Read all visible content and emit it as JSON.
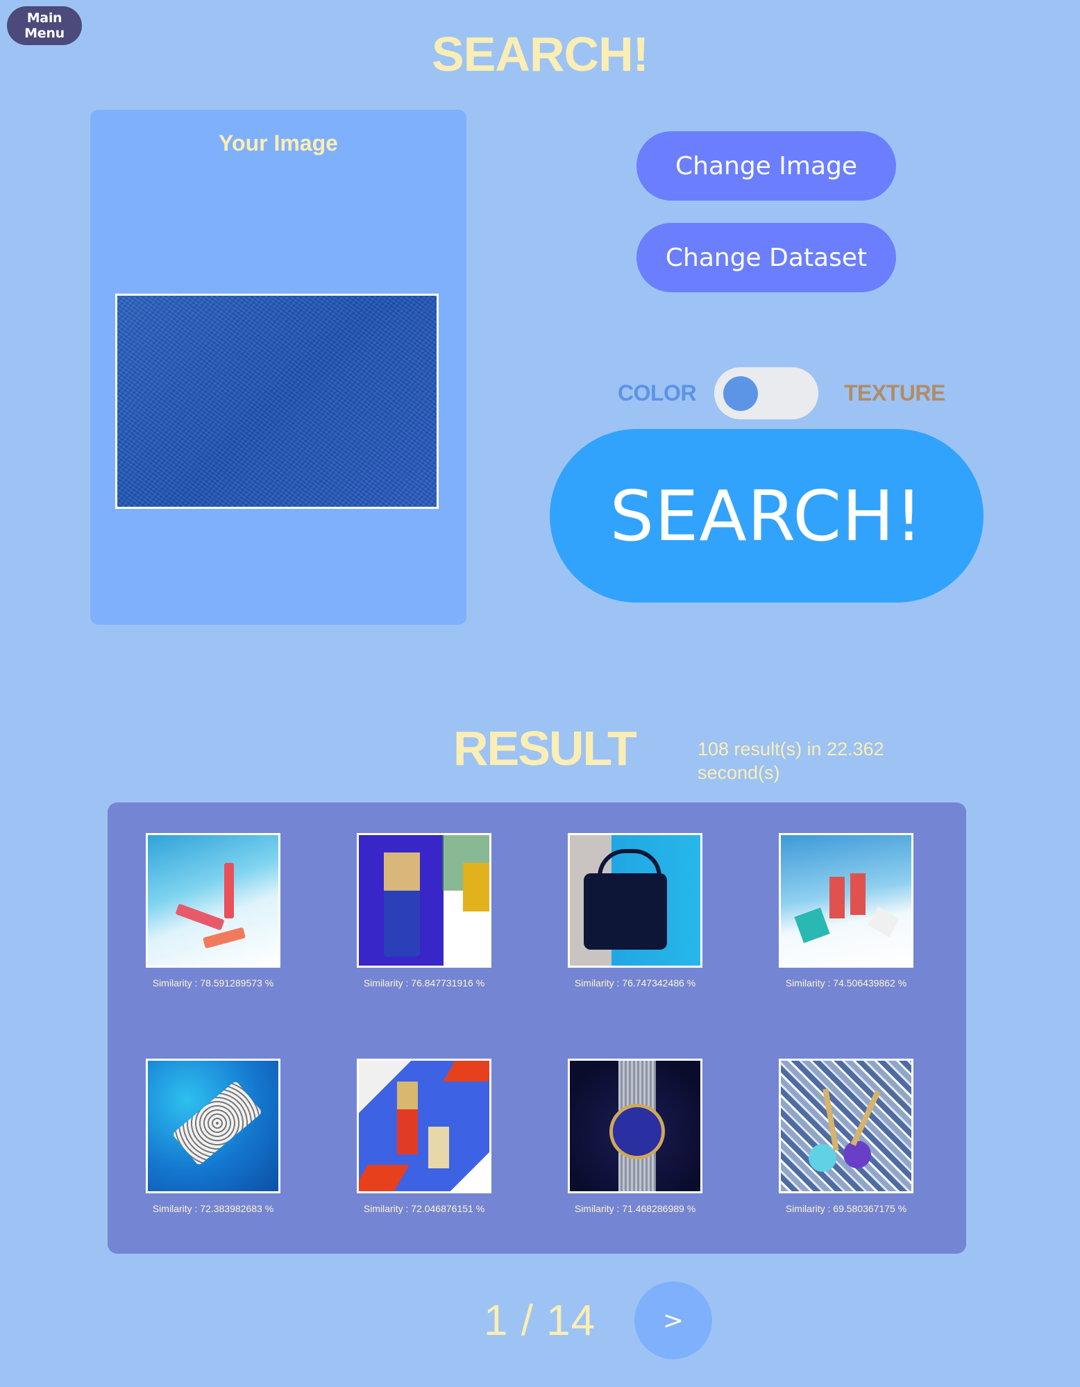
{
  "header": {
    "main_menu_label": "Main Menu",
    "title": "SEARCH!"
  },
  "query": {
    "card_title": "Your Image",
    "change_image_label": "Change Image",
    "change_dataset_label": "Change Dataset",
    "mode_left_label": "COLOR",
    "mode_right_label": "TEXTURE",
    "mode_selected": "COLOR",
    "search_label": "SEARCH!"
  },
  "results": {
    "title": "RESULT",
    "stats": "108 result(s) in 22.362 second(s)",
    "items": [
      {
        "similarity": "Similarity : 78.591289573 %"
      },
      {
        "similarity": "Similarity : 76.847731916 %"
      },
      {
        "similarity": "Similarity : 76.747342486 %"
      },
      {
        "similarity": "Similarity : 74.506439862 %"
      },
      {
        "similarity": "Similarity : 72.383982683 %"
      },
      {
        "similarity": "Similarity : 72.046876151 %"
      },
      {
        "similarity": "Similarity : 71.468286989 %"
      },
      {
        "similarity": "Similarity : 69.580367175 %"
      }
    ]
  },
  "pagination": {
    "indicator": "1 / 14",
    "next_label": ">"
  },
  "colors": {
    "background": "#9dc3f4",
    "accent_title": "#fbeeb4",
    "button": "#6b7ffe",
    "search_button": "#32a3fd",
    "results_panel": "#7485d3"
  }
}
